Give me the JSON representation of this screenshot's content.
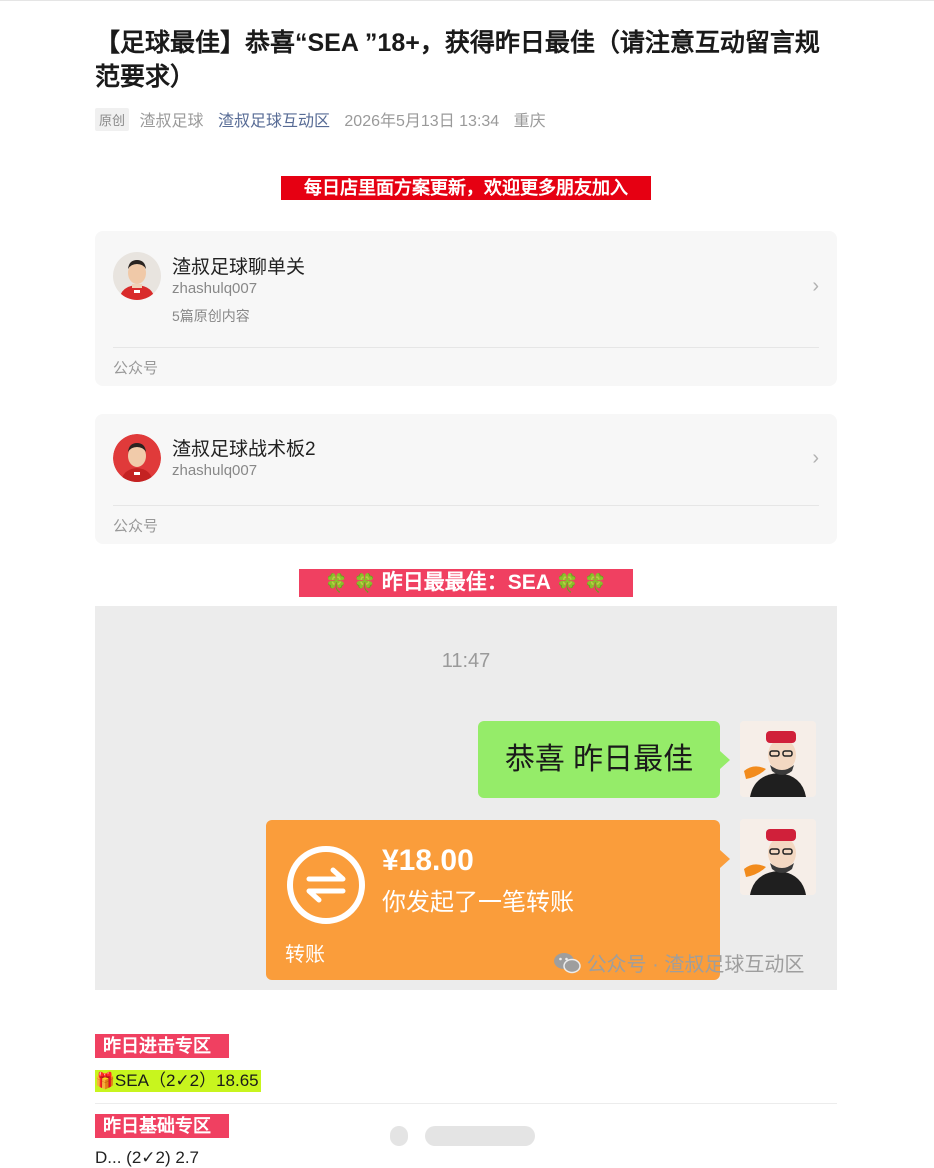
{
  "article": {
    "title": "【足球最佳】恭喜“SEA ”18+，获得昨日最佳（请注意互动留言规范要求）",
    "original_badge": "原创",
    "author": "渣叔足球",
    "account": "渣叔足球互动区",
    "date": "2026年5月13日 13:34",
    "location": "重庆"
  },
  "banner_top": "每日店里面方案更新，欢迎更多朋友加入",
  "cards": [
    {
      "name": "渣叔足球聊单关",
      "id": "zhashulq007",
      "count": "5篇原创内容",
      "footer": "公众号"
    },
    {
      "name": "渣叔足球战术板2",
      "id": "zhashulq007",
      "footer": "公众号"
    }
  ],
  "best_banner": {
    "clover": "🍀",
    "text": "昨日最最佳：SEA"
  },
  "chat": {
    "time": "11:47",
    "message": "恭喜 昨日最佳",
    "transfer": {
      "amount": "¥18.00",
      "description": "你发起了一笔转账",
      "label": "转账"
    },
    "watermark": "公众号 · 渣叔足球互动区"
  },
  "sections": [
    {
      "title": "昨日进击专区",
      "line_icon": "🎁",
      "line": "SEA（2✓2）18.65"
    },
    {
      "title": "昨日基础专区",
      "line": "D... (2✓2) 2.7"
    }
  ],
  "colors": {
    "banner_red": "#e60012",
    "tag_pink": "#f04061",
    "wechat_green": "#95ec69",
    "transfer_orange": "#fa9d3b",
    "highlight": "#c8f51e",
    "link": "#576b95"
  }
}
